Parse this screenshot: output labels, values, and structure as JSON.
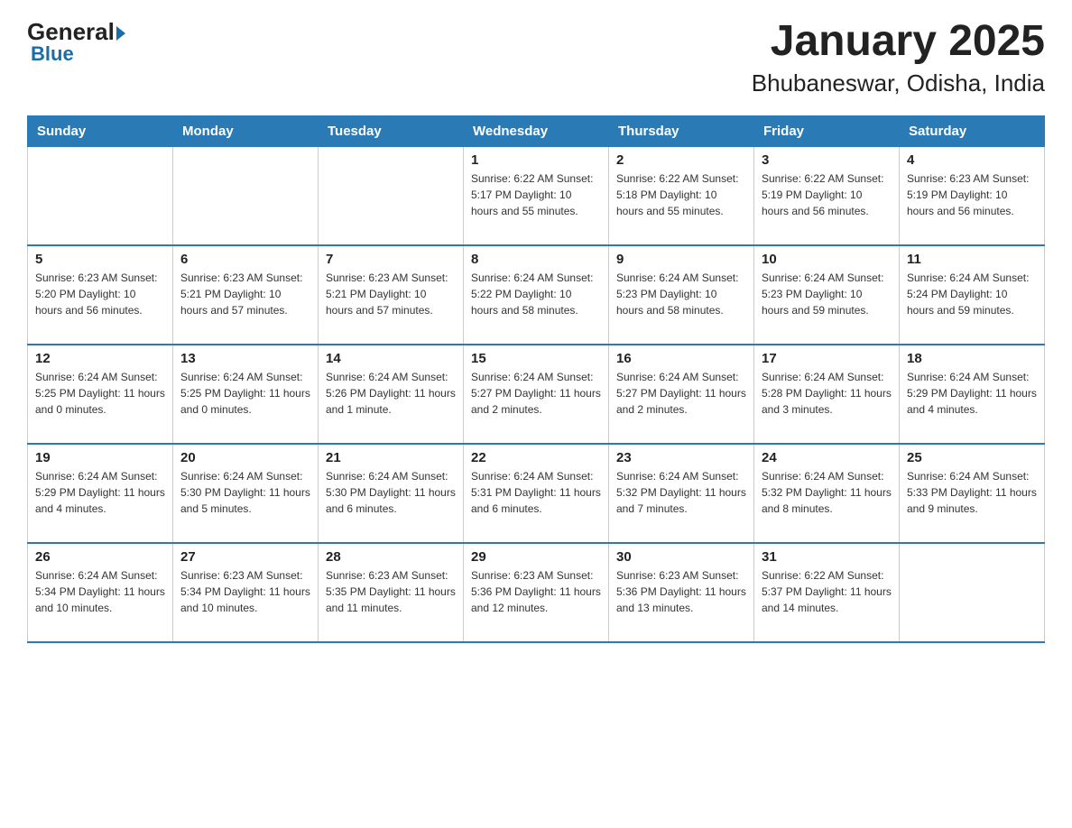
{
  "header": {
    "logo_general": "General",
    "logo_blue": "Blue",
    "title": "January 2025",
    "subtitle": "Bhubaneswar, Odisha, India"
  },
  "calendar": {
    "days_of_week": [
      "Sunday",
      "Monday",
      "Tuesday",
      "Wednesday",
      "Thursday",
      "Friday",
      "Saturday"
    ],
    "weeks": [
      [
        {
          "day": "",
          "info": ""
        },
        {
          "day": "",
          "info": ""
        },
        {
          "day": "",
          "info": ""
        },
        {
          "day": "1",
          "info": "Sunrise: 6:22 AM\nSunset: 5:17 PM\nDaylight: 10 hours\nand 55 minutes."
        },
        {
          "day": "2",
          "info": "Sunrise: 6:22 AM\nSunset: 5:18 PM\nDaylight: 10 hours\nand 55 minutes."
        },
        {
          "day": "3",
          "info": "Sunrise: 6:22 AM\nSunset: 5:19 PM\nDaylight: 10 hours\nand 56 minutes."
        },
        {
          "day": "4",
          "info": "Sunrise: 6:23 AM\nSunset: 5:19 PM\nDaylight: 10 hours\nand 56 minutes."
        }
      ],
      [
        {
          "day": "5",
          "info": "Sunrise: 6:23 AM\nSunset: 5:20 PM\nDaylight: 10 hours\nand 56 minutes."
        },
        {
          "day": "6",
          "info": "Sunrise: 6:23 AM\nSunset: 5:21 PM\nDaylight: 10 hours\nand 57 minutes."
        },
        {
          "day": "7",
          "info": "Sunrise: 6:23 AM\nSunset: 5:21 PM\nDaylight: 10 hours\nand 57 minutes."
        },
        {
          "day": "8",
          "info": "Sunrise: 6:24 AM\nSunset: 5:22 PM\nDaylight: 10 hours\nand 58 minutes."
        },
        {
          "day": "9",
          "info": "Sunrise: 6:24 AM\nSunset: 5:23 PM\nDaylight: 10 hours\nand 58 minutes."
        },
        {
          "day": "10",
          "info": "Sunrise: 6:24 AM\nSunset: 5:23 PM\nDaylight: 10 hours\nand 59 minutes."
        },
        {
          "day": "11",
          "info": "Sunrise: 6:24 AM\nSunset: 5:24 PM\nDaylight: 10 hours\nand 59 minutes."
        }
      ],
      [
        {
          "day": "12",
          "info": "Sunrise: 6:24 AM\nSunset: 5:25 PM\nDaylight: 11 hours\nand 0 minutes."
        },
        {
          "day": "13",
          "info": "Sunrise: 6:24 AM\nSunset: 5:25 PM\nDaylight: 11 hours\nand 0 minutes."
        },
        {
          "day": "14",
          "info": "Sunrise: 6:24 AM\nSunset: 5:26 PM\nDaylight: 11 hours\nand 1 minute."
        },
        {
          "day": "15",
          "info": "Sunrise: 6:24 AM\nSunset: 5:27 PM\nDaylight: 11 hours\nand 2 minutes."
        },
        {
          "day": "16",
          "info": "Sunrise: 6:24 AM\nSunset: 5:27 PM\nDaylight: 11 hours\nand 2 minutes."
        },
        {
          "day": "17",
          "info": "Sunrise: 6:24 AM\nSunset: 5:28 PM\nDaylight: 11 hours\nand 3 minutes."
        },
        {
          "day": "18",
          "info": "Sunrise: 6:24 AM\nSunset: 5:29 PM\nDaylight: 11 hours\nand 4 minutes."
        }
      ],
      [
        {
          "day": "19",
          "info": "Sunrise: 6:24 AM\nSunset: 5:29 PM\nDaylight: 11 hours\nand 4 minutes."
        },
        {
          "day": "20",
          "info": "Sunrise: 6:24 AM\nSunset: 5:30 PM\nDaylight: 11 hours\nand 5 minutes."
        },
        {
          "day": "21",
          "info": "Sunrise: 6:24 AM\nSunset: 5:30 PM\nDaylight: 11 hours\nand 6 minutes."
        },
        {
          "day": "22",
          "info": "Sunrise: 6:24 AM\nSunset: 5:31 PM\nDaylight: 11 hours\nand 6 minutes."
        },
        {
          "day": "23",
          "info": "Sunrise: 6:24 AM\nSunset: 5:32 PM\nDaylight: 11 hours\nand 7 minutes."
        },
        {
          "day": "24",
          "info": "Sunrise: 6:24 AM\nSunset: 5:32 PM\nDaylight: 11 hours\nand 8 minutes."
        },
        {
          "day": "25",
          "info": "Sunrise: 6:24 AM\nSunset: 5:33 PM\nDaylight: 11 hours\nand 9 minutes."
        }
      ],
      [
        {
          "day": "26",
          "info": "Sunrise: 6:24 AM\nSunset: 5:34 PM\nDaylight: 11 hours\nand 10 minutes."
        },
        {
          "day": "27",
          "info": "Sunrise: 6:23 AM\nSunset: 5:34 PM\nDaylight: 11 hours\nand 10 minutes."
        },
        {
          "day": "28",
          "info": "Sunrise: 6:23 AM\nSunset: 5:35 PM\nDaylight: 11 hours\nand 11 minutes."
        },
        {
          "day": "29",
          "info": "Sunrise: 6:23 AM\nSunset: 5:36 PM\nDaylight: 11 hours\nand 12 minutes."
        },
        {
          "day": "30",
          "info": "Sunrise: 6:23 AM\nSunset: 5:36 PM\nDaylight: 11 hours\nand 13 minutes."
        },
        {
          "day": "31",
          "info": "Sunrise: 6:22 AM\nSunset: 5:37 PM\nDaylight: 11 hours\nand 14 minutes."
        },
        {
          "day": "",
          "info": ""
        }
      ]
    ]
  }
}
